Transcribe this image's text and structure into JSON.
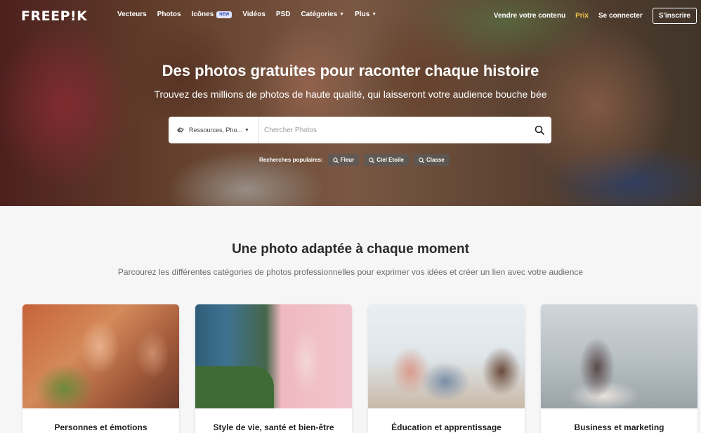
{
  "header": {
    "logo": "FREEP!K",
    "nav": [
      {
        "label": "Vecteurs"
      },
      {
        "label": "Photos"
      },
      {
        "label": "Icônes",
        "badge": "NEW"
      },
      {
        "label": "Vidéos"
      },
      {
        "label": "PSD"
      },
      {
        "label": "Catégories",
        "dropdown": true
      },
      {
        "label": "Plus",
        "dropdown": true
      }
    ],
    "right": {
      "sell": "Vendre votre contenu",
      "pricing": "Prix",
      "login": "Se connecter",
      "signup": "S'inscrire"
    }
  },
  "hero": {
    "title": "Des photos gratuites pour raconter chaque histoire",
    "subtitle": "Trouvez des millions de photos de haute qualité, qui laisseront votre audience bouche bée",
    "search": {
      "filter_label": "Ressources, Pho...",
      "placeholder": "Chercher Photos",
      "value": ""
    },
    "popular": {
      "label": "Recherches populaires:",
      "tags": [
        "Fleur",
        "Ciel Etoile",
        "Classe"
      ]
    }
  },
  "section": {
    "title": "Une photo adaptée à chaque moment",
    "subtitle": "Parcourez les différentes catégories de photos professionnelles pour exprimer vos idées et créer un lien avec votre audience",
    "cards": [
      {
        "label": "Personnes et émotions"
      },
      {
        "label": "Style de vie, santé et bien-être"
      },
      {
        "label": "Éducation et apprentissage"
      },
      {
        "label": "Business et marketing"
      }
    ]
  },
  "colors": {
    "accent_pricing": "#f3c24d",
    "badge_bg": "#dfe6ff",
    "page_bg": "#f6f6f7"
  }
}
